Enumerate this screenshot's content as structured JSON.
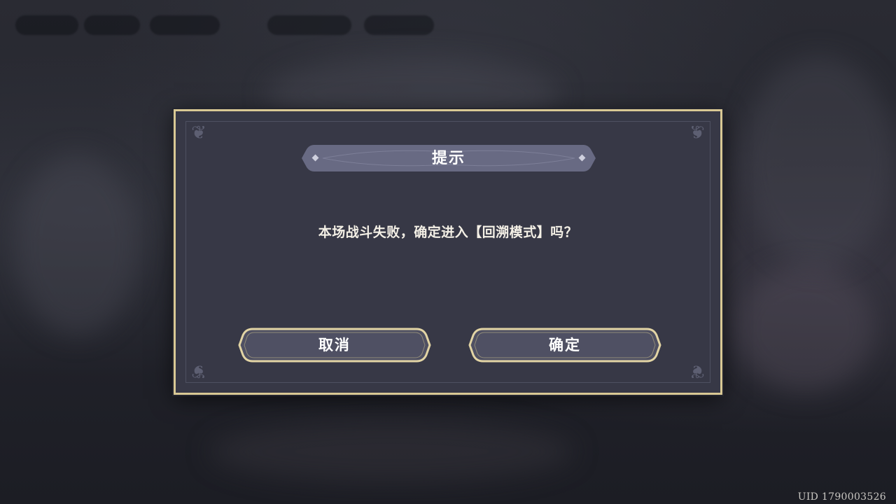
{
  "dialog": {
    "title": "提示",
    "message": "本场战斗失败，确定进入【回溯模式】吗？",
    "cancel_label": "取消",
    "confirm_label": "确定"
  },
  "footer": {
    "uid": "UID 1790003526"
  },
  "colors": {
    "frame_gold": "#d9c894",
    "panel": "#373846",
    "title_band": "#6b6d86",
    "button_fill": "#4f5063"
  }
}
